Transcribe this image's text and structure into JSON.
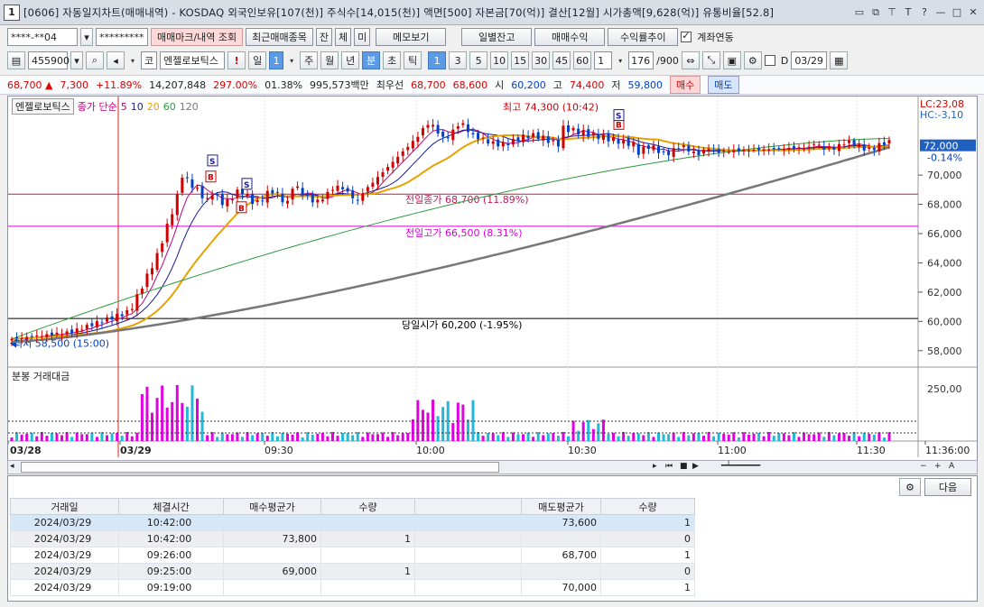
{
  "window": {
    "number": "1",
    "title": "[0606] 자동일지차트(매매내역) - KOSDAQ 외국인보유[107(천)] 주식수[14,015(천)] 액면[500] 자본금[70(억)] 결산[12월] 시가총액[9,628(억)] 유통비율[52.8]"
  },
  "toolbar1": {
    "account": "****-**04",
    "password": "*********",
    "mark_button": "매매마크/내역 조회",
    "recent_button": "최근매매종목",
    "b1": "잔",
    "b2": "체",
    "b3": "미",
    "memo_button": "메모보기",
    "daily_button": "일별잔고",
    "profit_button": "매매수익",
    "rate_button": "수익률추이",
    "link_label": "계좌연동",
    "link_checked": true
  },
  "toolbar2": {
    "stock_code": "455900",
    "market": "코",
    "stock_name": "엔젤로보틱스",
    "excl": "!",
    "period_day": "일",
    "period_num": "1",
    "w": "주",
    "m": "월",
    "y": "년",
    "min": "분",
    "sec": "초",
    "tick": "틱",
    "intervals": [
      "1",
      "3",
      "5",
      "10",
      "15",
      "30",
      "45",
      "60"
    ],
    "interval_sel": "1",
    "count": "176",
    "count_total": "/900",
    "d_label": "D",
    "date": "03/29"
  },
  "price_bar": {
    "price": "68,700",
    "change_arrow": "▲",
    "change": "7,300",
    "change_pct": "+11.89%",
    "volume": "14,207,848",
    "vol_ratio": "297.00%",
    "turnover": "01.38%",
    "amount": "995,573백만",
    "best_ask_label": "최우선",
    "ask": "68,700",
    "bid": "68,600",
    "open_label": "시",
    "open": "60,200",
    "high_label": "고",
    "high": "74,400",
    "low_label": "저",
    "low": "59,800",
    "buy_button": "매수",
    "sell_button": "매도"
  },
  "chart_legend": {
    "name": "엔젤로보틱스",
    "series_label": "종가 단순",
    "ma": [
      "5",
      "10",
      "20",
      "60",
      "120"
    ],
    "lc": "LC:23,08",
    "hc": "HC:-3,10"
  },
  "price_axis": {
    "current": "72,000",
    "current_pct": "-0.14%",
    "ticks": [
      "70,000",
      "68,000",
      "66,000",
      "64,000",
      "62,000",
      "60,000",
      "58,000"
    ]
  },
  "annotations": {
    "high": "최고 74,300 (10:42)",
    "prev_close": "전일종가 68,700 (11.89%)",
    "prev_high": "전일고가 66,500 (8.31%)",
    "open": "당일시가 60,200 (-1.95%)",
    "low": "최저 58,500 (15:00)"
  },
  "volume_legend": "분봉 거래대금",
  "volume_axis": "250,00",
  "time_axis": [
    "03/28",
    "03/29",
    "09:30",
    "10:00",
    "10:30",
    "11:00",
    "11:30",
    "11:36:00"
  ],
  "chart_data": {
    "type": "candlestick",
    "ylim": [
      57000,
      75000
    ],
    "moving_averages": [
      "5",
      "10",
      "20",
      "60",
      "120"
    ],
    "horizontal_lines": [
      68700,
      66500,
      60200
    ]
  },
  "table": {
    "headers": [
      "거래일",
      "체결시간",
      "매수평균가",
      "수량",
      "",
      "매도평균가",
      "수량"
    ],
    "rows": [
      [
        "2024/03/29",
        "10:42:00",
        "",
        "",
        "",
        "73,600",
        "1"
      ],
      [
        "2024/03/29",
        "10:42:00",
        "73,800",
        "1",
        "",
        "",
        "0"
      ],
      [
        "2024/03/29",
        "09:26:00",
        "",
        "",
        "",
        "68,700",
        "1"
      ],
      [
        "2024/03/29",
        "09:25:00",
        "69,000",
        "1",
        "",
        "",
        "0"
      ],
      [
        "2024/03/29",
        "09:19:00",
        "",
        "",
        "",
        "70,000",
        "1"
      ]
    ],
    "next_button": "다음"
  },
  "colors": {
    "up": "#d00000",
    "down": "#0041c8",
    "ma5": "#c0007a",
    "ma10": "#1b1b9a",
    "ma20": "#e8a200",
    "ma60": "#2e9a3a",
    "ma120": "#777777"
  }
}
